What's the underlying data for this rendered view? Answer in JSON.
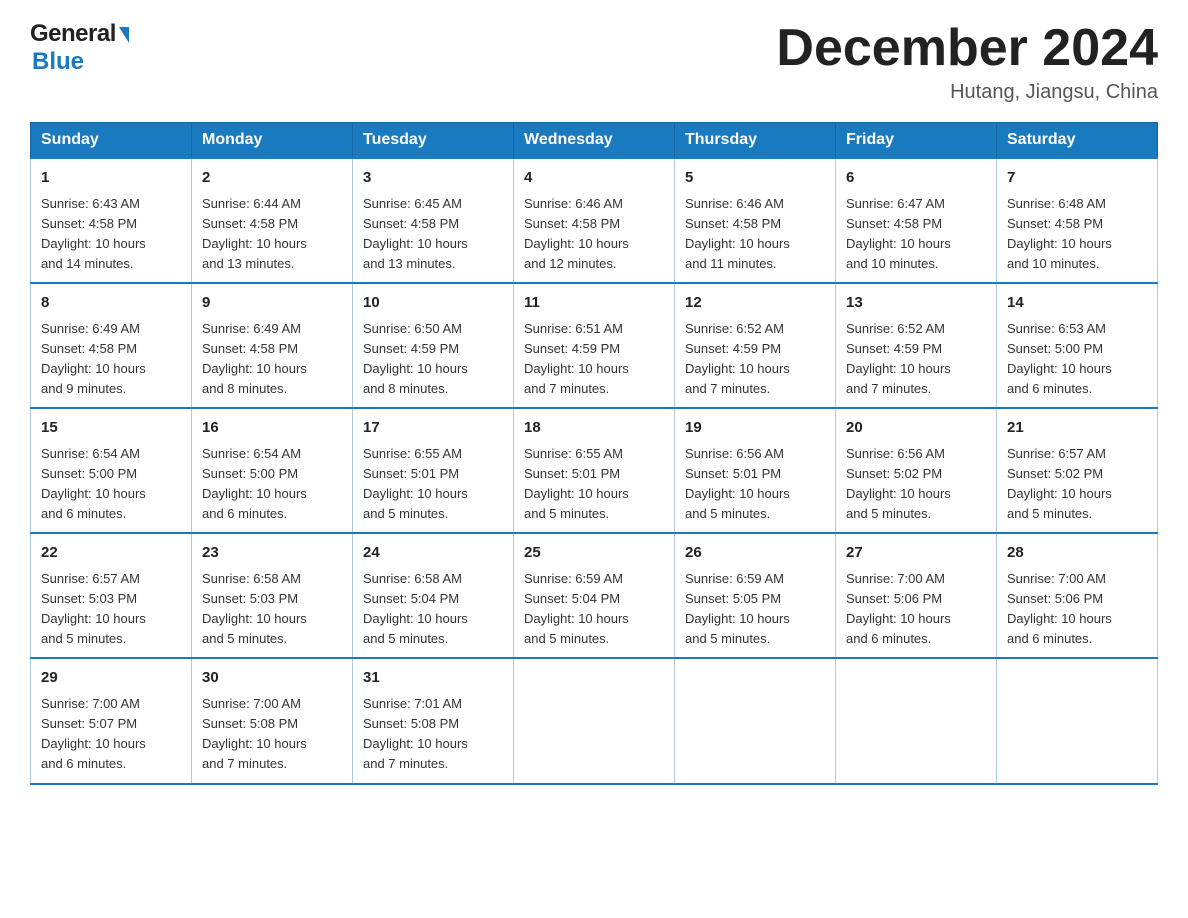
{
  "header": {
    "logo_general": "General",
    "logo_blue": "Blue",
    "month_title": "December 2024",
    "location": "Hutang, Jiangsu, China"
  },
  "days_of_week": [
    "Sunday",
    "Monday",
    "Tuesday",
    "Wednesday",
    "Thursday",
    "Friday",
    "Saturday"
  ],
  "weeks": [
    [
      {
        "day": "1",
        "sunrise": "6:43 AM",
        "sunset": "4:58 PM",
        "daylight": "10 hours and 14 minutes."
      },
      {
        "day": "2",
        "sunrise": "6:44 AM",
        "sunset": "4:58 PM",
        "daylight": "10 hours and 13 minutes."
      },
      {
        "day": "3",
        "sunrise": "6:45 AM",
        "sunset": "4:58 PM",
        "daylight": "10 hours and 13 minutes."
      },
      {
        "day": "4",
        "sunrise": "6:46 AM",
        "sunset": "4:58 PM",
        "daylight": "10 hours and 12 minutes."
      },
      {
        "day": "5",
        "sunrise": "6:46 AM",
        "sunset": "4:58 PM",
        "daylight": "10 hours and 11 minutes."
      },
      {
        "day": "6",
        "sunrise": "6:47 AM",
        "sunset": "4:58 PM",
        "daylight": "10 hours and 10 minutes."
      },
      {
        "day": "7",
        "sunrise": "6:48 AM",
        "sunset": "4:58 PM",
        "daylight": "10 hours and 10 minutes."
      }
    ],
    [
      {
        "day": "8",
        "sunrise": "6:49 AM",
        "sunset": "4:58 PM",
        "daylight": "10 hours and 9 minutes."
      },
      {
        "day": "9",
        "sunrise": "6:49 AM",
        "sunset": "4:58 PM",
        "daylight": "10 hours and 8 minutes."
      },
      {
        "day": "10",
        "sunrise": "6:50 AM",
        "sunset": "4:59 PM",
        "daylight": "10 hours and 8 minutes."
      },
      {
        "day": "11",
        "sunrise": "6:51 AM",
        "sunset": "4:59 PM",
        "daylight": "10 hours and 7 minutes."
      },
      {
        "day": "12",
        "sunrise": "6:52 AM",
        "sunset": "4:59 PM",
        "daylight": "10 hours and 7 minutes."
      },
      {
        "day": "13",
        "sunrise": "6:52 AM",
        "sunset": "4:59 PM",
        "daylight": "10 hours and 7 minutes."
      },
      {
        "day": "14",
        "sunrise": "6:53 AM",
        "sunset": "5:00 PM",
        "daylight": "10 hours and 6 minutes."
      }
    ],
    [
      {
        "day": "15",
        "sunrise": "6:54 AM",
        "sunset": "5:00 PM",
        "daylight": "10 hours and 6 minutes."
      },
      {
        "day": "16",
        "sunrise": "6:54 AM",
        "sunset": "5:00 PM",
        "daylight": "10 hours and 6 minutes."
      },
      {
        "day": "17",
        "sunrise": "6:55 AM",
        "sunset": "5:01 PM",
        "daylight": "10 hours and 5 minutes."
      },
      {
        "day": "18",
        "sunrise": "6:55 AM",
        "sunset": "5:01 PM",
        "daylight": "10 hours and 5 minutes."
      },
      {
        "day": "19",
        "sunrise": "6:56 AM",
        "sunset": "5:01 PM",
        "daylight": "10 hours and 5 minutes."
      },
      {
        "day": "20",
        "sunrise": "6:56 AM",
        "sunset": "5:02 PM",
        "daylight": "10 hours and 5 minutes."
      },
      {
        "day": "21",
        "sunrise": "6:57 AM",
        "sunset": "5:02 PM",
        "daylight": "10 hours and 5 minutes."
      }
    ],
    [
      {
        "day": "22",
        "sunrise": "6:57 AM",
        "sunset": "5:03 PM",
        "daylight": "10 hours and 5 minutes."
      },
      {
        "day": "23",
        "sunrise": "6:58 AM",
        "sunset": "5:03 PM",
        "daylight": "10 hours and 5 minutes."
      },
      {
        "day": "24",
        "sunrise": "6:58 AM",
        "sunset": "5:04 PM",
        "daylight": "10 hours and 5 minutes."
      },
      {
        "day": "25",
        "sunrise": "6:59 AM",
        "sunset": "5:04 PM",
        "daylight": "10 hours and 5 minutes."
      },
      {
        "day": "26",
        "sunrise": "6:59 AM",
        "sunset": "5:05 PM",
        "daylight": "10 hours and 5 minutes."
      },
      {
        "day": "27",
        "sunrise": "7:00 AM",
        "sunset": "5:06 PM",
        "daylight": "10 hours and 6 minutes."
      },
      {
        "day": "28",
        "sunrise": "7:00 AM",
        "sunset": "5:06 PM",
        "daylight": "10 hours and 6 minutes."
      }
    ],
    [
      {
        "day": "29",
        "sunrise": "7:00 AM",
        "sunset": "5:07 PM",
        "daylight": "10 hours and 6 minutes."
      },
      {
        "day": "30",
        "sunrise": "7:00 AM",
        "sunset": "5:08 PM",
        "daylight": "10 hours and 7 minutes."
      },
      {
        "day": "31",
        "sunrise": "7:01 AM",
        "sunset": "5:08 PM",
        "daylight": "10 hours and 7 minutes."
      },
      null,
      null,
      null,
      null
    ]
  ],
  "labels": {
    "sunrise": "Sunrise:",
    "sunset": "Sunset:",
    "daylight": "Daylight:"
  }
}
